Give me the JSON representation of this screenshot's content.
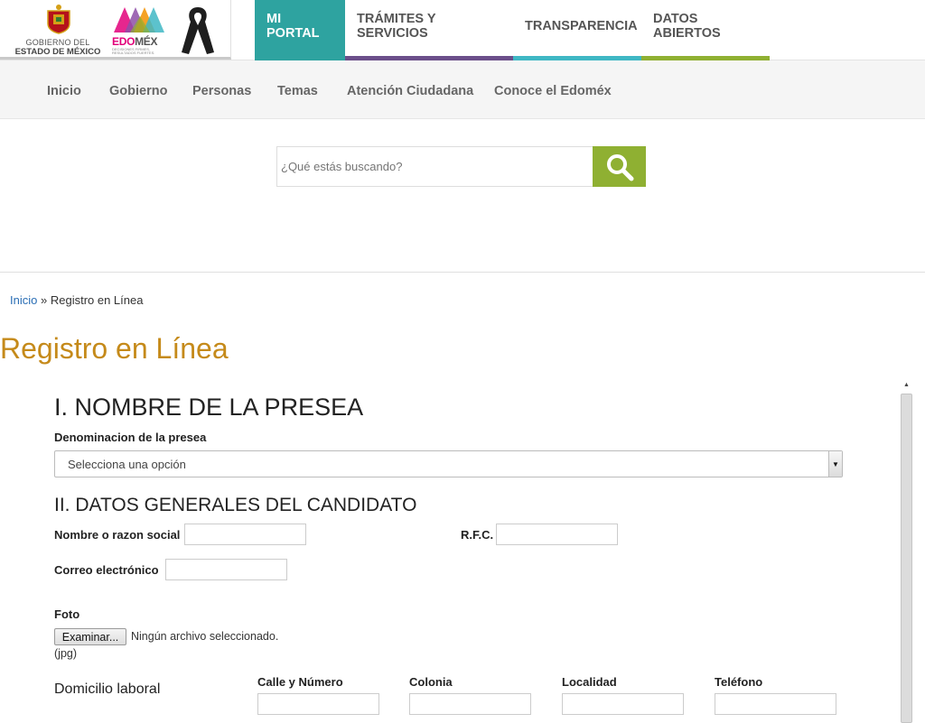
{
  "header": {
    "gob_logo_line1": "GOBIERNO DEL",
    "gob_logo_line2": "ESTADO DE MÉXICO",
    "edomex_logo_a": "EDO",
    "edomex_logo_b": "MÉX",
    "edomex_tagline": "DECISIONES FIRMES, RESULTADOS FUERTES.",
    "top_nav": [
      {
        "label": "MI PORTAL",
        "active": true,
        "color": "#2ea3a0"
      },
      {
        "label": "TRÁMITES Y SERVICIOS",
        "color": "#6b4f8a"
      },
      {
        "label": "TRANSPARENCIA",
        "color": "#3fb7c4"
      },
      {
        "label": "DATOS ABIERTOS",
        "color": "#8fb032"
      }
    ]
  },
  "sub_nav": [
    "Inicio",
    "Gobierno",
    "Personas",
    "Temas",
    "Atención Ciudadana",
    "Conoce el Edoméx"
  ],
  "search": {
    "placeholder": "¿Qué estás buscando?",
    "button_icon": "search-icon",
    "button_color": "#8fb032"
  },
  "breadcrumb": {
    "home": "Inicio",
    "separator": "»",
    "current": "Registro en Línea"
  },
  "page_title": "Registro en Línea",
  "form": {
    "section1_title": "I. NOMBRE DE LA PRESEA",
    "presea_label": "Denominacion de la presea",
    "presea_select_value": "Selecciona una opción",
    "section2_title": "II. DATOS GENERALES DEL CANDIDATO",
    "nombre_label": "Nombre o razon social",
    "rfc_label": "R.F.C.",
    "correo_label": "Correo electrónico",
    "foto_label": "Foto",
    "file_button": "Examinar...",
    "file_status": "Ningún archivo seleccionado.",
    "file_hint": "(jpg)",
    "domicilio_label": "Domicilio laboral",
    "domicilio_columns": [
      "Calle y Número",
      "Colonia",
      "Localidad",
      "Teléfono"
    ]
  },
  "colors": {
    "title": "#c58a1a",
    "link": "#2a6eb5"
  }
}
